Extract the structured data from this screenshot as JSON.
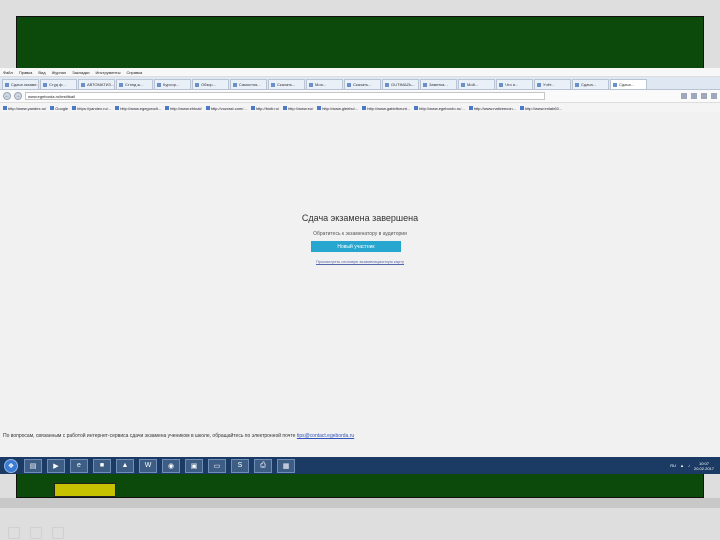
{
  "browser": {
    "menu": [
      "Файл",
      "Правка",
      "Вид",
      "Журнал",
      "Закладки",
      "Инструменты",
      "Справка"
    ],
    "tabs": [
      "Сдача экзаме...",
      "Студ ф...",
      "АВТОМАТИЗ...",
      "Стэнд ж...",
      "Курсор...",
      "Обзор...",
      "Самостоя...",
      "Скачать...",
      "Моя...",
      "Скачать...",
      "GUTIMAZЬ...",
      "Заметка...",
      "Мой...",
      "Что и...",
      "Учёт...",
      "Сдача...",
      "Сдача..."
    ],
    "active_tab_index": 16,
    "url": "www.egeborda.ru/test/tkall",
    "bookmarks": [
      "http://www.yandex.ru/",
      "Google",
      "https://yandex.ru/...",
      "http://www.egegorodt...",
      "http://www.ehtcat/",
      "http://vozrast.com/...",
      "http://biofr.ru/",
      "http://www.eu/",
      "http://www.gleebo/...",
      "http://www.gabidforunt...",
      "http://www.egebordo.ru/...",
      "http://www.nativeecon...",
      "http://www.enlab63..."
    ]
  },
  "exam": {
    "title": "Сдача экзамена завершена",
    "subtitle": "Обратитесь к экзаменатору в аудитории",
    "new_attempt_button": "Новый участник",
    "link": "Просмотреть итоговую экзаменационную карту"
  },
  "footer": {
    "text": "По вопросам, связанным с работой интернет-сервиса сдачи экзамена учеником в школе, обращайтесь по электронной почте",
    "email": "tips@contact.egeborda.ru"
  },
  "taskbar": {
    "apps": [
      "explorer",
      "firefox-browser",
      "ie-browser",
      "folder",
      "lock-app",
      "word",
      "firefox",
      "winrar",
      "notepad",
      "skype",
      "printer",
      "paint"
    ],
    "tray_lang": "RU",
    "time": "10:07",
    "date": "20.02.2017"
  },
  "colors": {
    "board": "#0c4a0c",
    "button": "#27a7cf",
    "taskbar": "#1c3b64"
  }
}
